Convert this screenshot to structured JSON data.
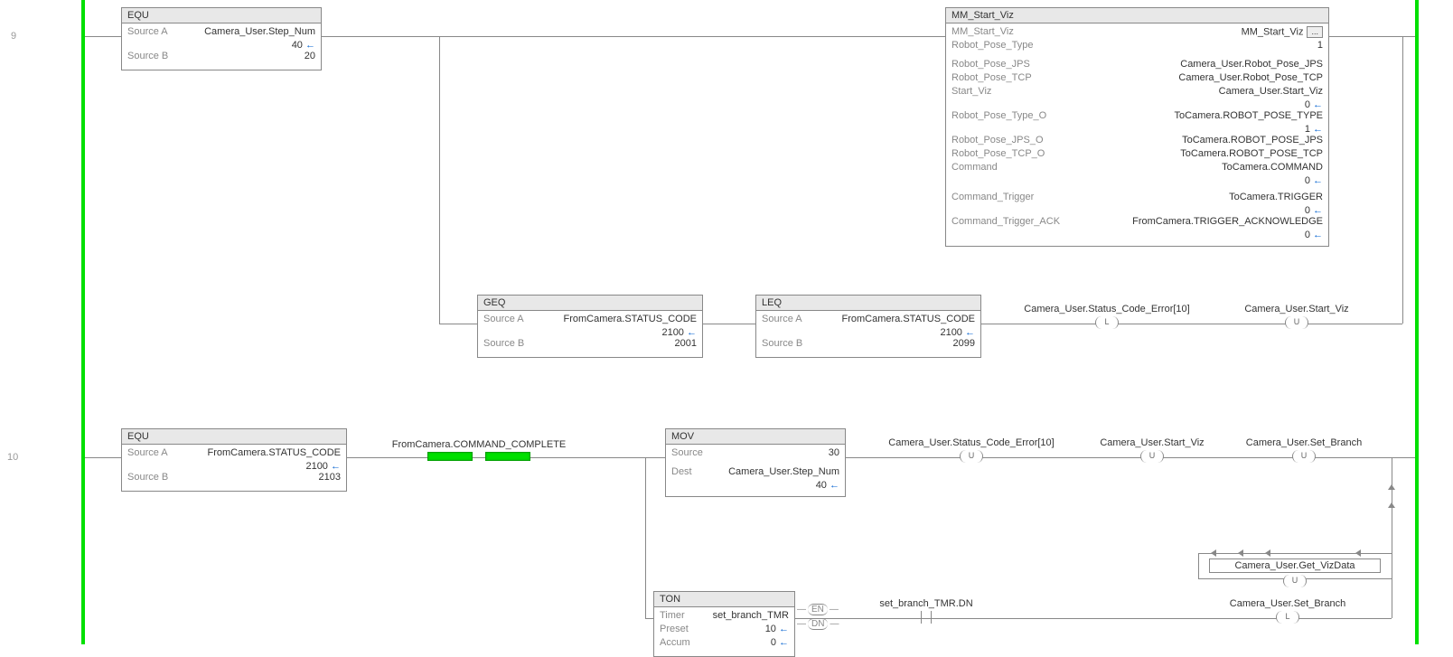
{
  "rungs": {
    "r9": "9",
    "r10": "10"
  },
  "rung9": {
    "equ": {
      "name": "EQU",
      "srcA_label": "Source A",
      "srcA_value": "Camera_User.Step_Num",
      "srcA_live": "40",
      "srcB_label": "Source B",
      "srcB_value": "20"
    },
    "mmsv": {
      "name": "MM_Start_Viz",
      "rows": [
        {
          "label": "MM_Start_Viz",
          "value": "MM_Start_Viz",
          "btn": true
        },
        {
          "label": "Robot_Pose_Type",
          "value": "1"
        }
      ],
      "rows2": [
        {
          "label": "Robot_Pose_JPS",
          "value": "Camera_User.Robot_Pose_JPS"
        },
        {
          "label": "Robot_Pose_TCP",
          "value": "Camera_User.Robot_Pose_TCP"
        },
        {
          "label": "Start_Viz",
          "value": "Camera_User.Start_Viz",
          "live": "0"
        },
        {
          "label": "Robot_Pose_Type_O",
          "value": "ToCamera.ROBOT_POSE_TYPE",
          "live": "1"
        },
        {
          "label": "Robot_Pose_JPS_O",
          "value": "ToCamera.ROBOT_POSE_JPS"
        },
        {
          "label": "Robot_Pose_TCP_O",
          "value": "ToCamera.ROBOT_POSE_TCP"
        },
        {
          "label": "Command",
          "value": "ToCamera.COMMAND",
          "live": "0"
        }
      ],
      "rows3": [
        {
          "label": "Command_Trigger",
          "value": "ToCamera.TRIGGER",
          "live": "0"
        },
        {
          "label": "Command_Trigger_ACK",
          "value": "FromCamera.TRIGGER_ACKNOWLEDGE",
          "live": "0"
        }
      ]
    },
    "geq": {
      "name": "GEQ",
      "srcA_label": "Source A",
      "srcA_value": "FromCamera.STATUS_CODE",
      "srcA_live": "2100",
      "srcB_label": "Source B",
      "srcB_value": "2001"
    },
    "leq": {
      "name": "LEQ",
      "srcA_label": "Source A",
      "srcA_value": "FromCamera.STATUS_CODE",
      "srcA_live": "2100",
      "srcB_label": "Source B",
      "srcB_value": "2099"
    },
    "coil_err": {
      "label": "Camera_User.Status_Code_Error[10]",
      "type": "L"
    },
    "coil_start": {
      "label": "Camera_User.Start_Viz",
      "type": "U"
    }
  },
  "rung10": {
    "equ": {
      "name": "EQU",
      "srcA_label": "Source A",
      "srcA_value": "FromCamera.STATUS_CODE",
      "srcA_live": "2100",
      "srcB_label": "Source B",
      "srcB_value": "2103"
    },
    "xic": {
      "label": "FromCamera.COMMAND_COMPLETE"
    },
    "mov": {
      "name": "MOV",
      "src_label": "Source",
      "src_value": "30",
      "dst_label": "Dest",
      "dst_value": "Camera_User.Step_Num",
      "dst_live": "40"
    },
    "coil_err": {
      "label": "Camera_User.Status_Code_Error[10]",
      "type": "U"
    },
    "coil_start": {
      "label": "Camera_User.Start_Viz",
      "type": "U"
    },
    "coil_setb": {
      "label": "Camera_User.Set_Branch",
      "type": "U"
    },
    "coil_getviz": {
      "label": "Camera_User.Get_VizData",
      "type": "U"
    },
    "ton": {
      "name": "TON",
      "timer_label": "Timer",
      "timer_value": "set_branch_TMR",
      "preset_label": "Preset",
      "preset_value": "10",
      "accum_label": "Accum",
      "accum_value": "0",
      "en": "EN",
      "dn": "DN"
    },
    "xic_dn": {
      "label": "set_branch_TMR.DN"
    },
    "coil_setb2": {
      "label": "Camera_User.Set_Branch",
      "type": "L"
    }
  }
}
